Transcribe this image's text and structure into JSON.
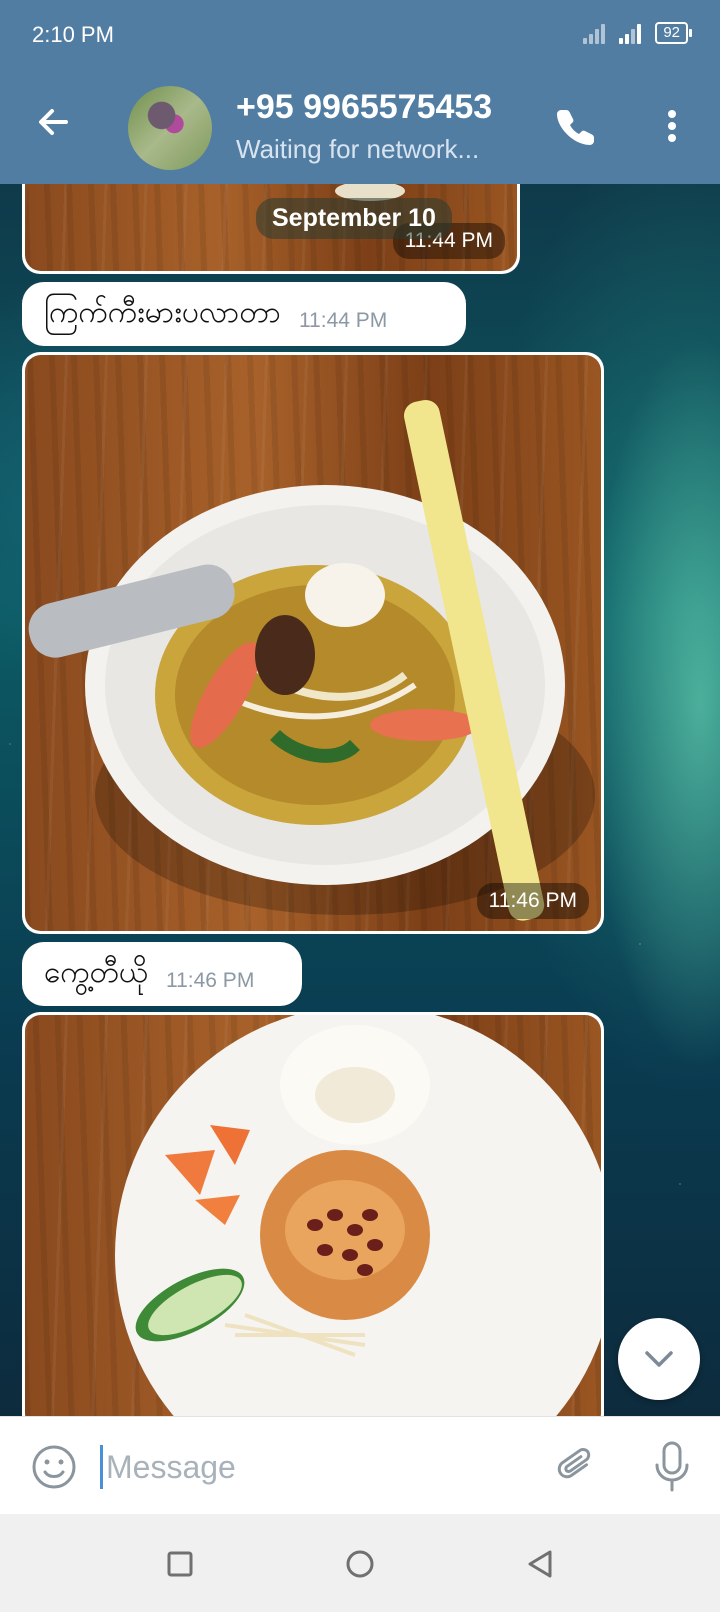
{
  "status_bar": {
    "time": "2:10 PM",
    "battery": "92"
  },
  "header": {
    "title": "+95 9965575453",
    "subtitle": "Waiting for network..."
  },
  "chat": {
    "date_pill": "September 10",
    "messages": [
      {
        "type": "photo",
        "time": "11:44 PM"
      },
      {
        "type": "text",
        "text": "ကြက်ကီးမားပလာတာ",
        "time": "11:44 PM"
      },
      {
        "type": "photo",
        "time": "11:46 PM"
      },
      {
        "type": "text",
        "text": "ကွေ့တီယို",
        "time": "11:46 PM"
      },
      {
        "type": "photo"
      }
    ]
  },
  "input": {
    "placeholder": "Message"
  },
  "colors": {
    "header_bg": "#527da3",
    "accent": "#4a90d9"
  }
}
